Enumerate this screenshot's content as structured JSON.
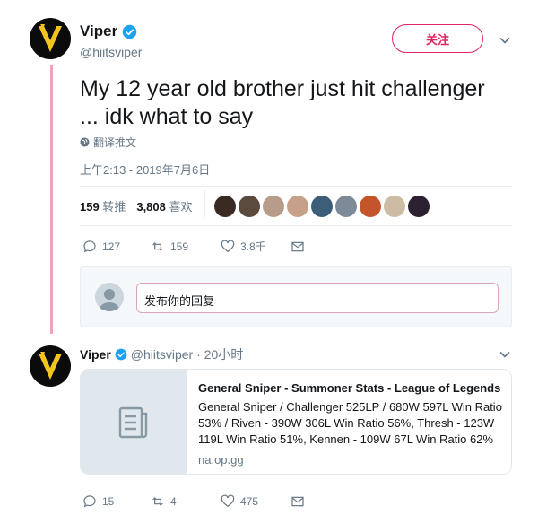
{
  "tweet": {
    "name": "Viper",
    "handle": "@hiitsviper",
    "follow_label": "关注",
    "text": "My 12 year old brother just hit challenger ... idk what to say",
    "translate_label": "翻译推文",
    "timestamp": "上午2:13 - 2019年7月6日",
    "retweet_count": "159",
    "retweet_label": "转推",
    "like_count": "3,808",
    "like_label": "喜欢",
    "likers": [
      {
        "color": "#3a2a22"
      },
      {
        "color": "#5a4b3e"
      },
      {
        "color": "#b89c8a"
      },
      {
        "color": "#c7a08a"
      },
      {
        "color": "#3d5e78"
      },
      {
        "color": "#7d8b99"
      },
      {
        "color": "#c4552a"
      },
      {
        "color": "#cdbba3"
      },
      {
        "color": "#2b2130"
      }
    ],
    "actions": {
      "replies": "127",
      "retweets": "159",
      "likes": "3.8千"
    },
    "reply_placeholder": "发布你的回复"
  },
  "reply_tweet": {
    "name": "Viper",
    "handle_time": "@hiitsviper · 20小时",
    "card": {
      "title": "General Sniper - Summoner Stats - League of Legends",
      "description": "General Sniper / Challenger 525LP / 680W 597L Win Ratio 53% / Riven - 390W 306L Win Ratio 56%, Thresh - 123W 119L Win Ratio 51%, Kennen - 109W 67L Win Ratio 62%",
      "domain": "na.op.gg"
    },
    "actions": {
      "replies": "15",
      "retweets": "4",
      "likes": "475"
    }
  },
  "colors": {
    "accent": "#e0245e",
    "verified": "#1da1f2",
    "muted": "#657786",
    "thread_line": "#e9a6bf"
  }
}
